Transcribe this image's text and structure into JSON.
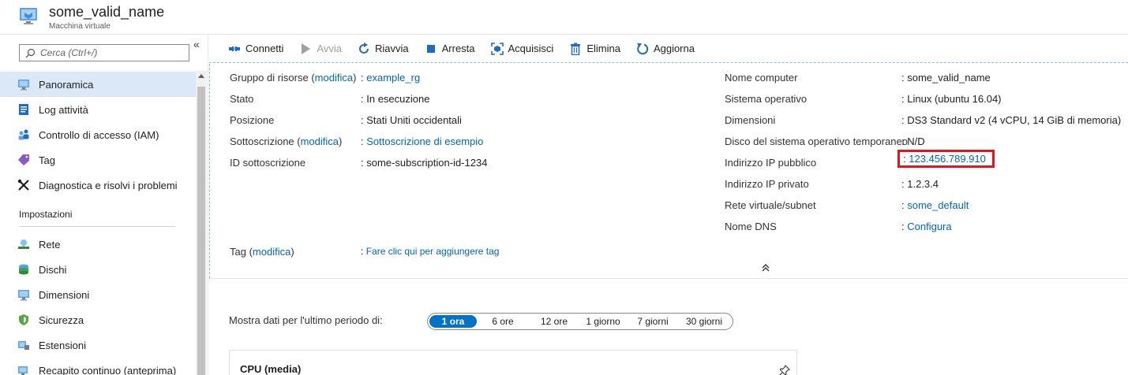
{
  "header": {
    "title": "some_valid_name",
    "subtitle": "Macchina virtuale"
  },
  "sidebar": {
    "collapse_label": "«",
    "search_placeholder": "Cerca (Ctrl+/)",
    "items": [
      {
        "label": "Panoramica",
        "icon": "monitor-icon"
      },
      {
        "label": "Log attività",
        "icon": "log-icon"
      },
      {
        "label": "Controllo di accesso (IAM)",
        "icon": "people-icon"
      },
      {
        "label": "Tag",
        "icon": "tag-icon"
      },
      {
        "label": "Diagnostica e risolvi i problemi",
        "icon": "wrench-icon"
      }
    ],
    "section_title": "Impostazioni",
    "settings_items": [
      {
        "label": "Rete",
        "icon": "network-icon"
      },
      {
        "label": "Dischi",
        "icon": "disks-icon"
      },
      {
        "label": "Dimensioni",
        "icon": "monitor-icon"
      },
      {
        "label": "Sicurezza",
        "icon": "shield-icon"
      },
      {
        "label": "Estensioni",
        "icon": "extensions-icon"
      },
      {
        "label": "Recapito continuo (anteprima)",
        "icon": "rocket-icon"
      }
    ]
  },
  "toolbar": {
    "connect": "Connetti",
    "start": "Avvia",
    "restart": "Riavvia",
    "stop": "Arresta",
    "capture": "Acquisisci",
    "delete": "Elimina",
    "refresh": "Aggiorna"
  },
  "essentials": {
    "left": {
      "resource_group_label": "Gruppo di risorse (",
      "modify": "modifica",
      "close_paren": ")",
      "resource_group_value": "example_rg",
      "status_label": "Stato",
      "status_value": "In esecuzione",
      "location_label": "Posizione",
      "location_value": "Stati Uniti occidentali",
      "subscription_label": "Sottoscrizione (",
      "subscription_value": "Sottoscrizione di esempio",
      "subscription_id_label": "ID sottoscrizione",
      "subscription_id_value": "some-subscription-id-1234",
      "tags_label": "Tag (",
      "tags_value": "Fare clic qui per aggiungere tag"
    },
    "right": {
      "computer_name_label": "Nome computer",
      "computer_name_value": "some_valid_name",
      "os_label": "Sistema operativo",
      "os_value": "Linux (ubuntu 16.04)",
      "size_label": "Dimensioni",
      "size_value": "DS3 Standard v2 (4 vCPU, 14 GiB di memoria)",
      "temp_disk_label": "Disco del sistema operativo temporaneo",
      "temp_disk_value": "N/D",
      "public_ip_label": "Indirizzo IP pubblico",
      "public_ip_value": "123.456.789.910",
      "private_ip_label": "Indirizzo IP privato",
      "private_ip_value": "1.2.3.4",
      "vnet_label": "Rete virtuale/subnet",
      "vnet_value": "some_default",
      "dns_label": "Nome DNS",
      "dns_value": "Configura"
    },
    "colon": ":"
  },
  "metrics": {
    "period_label": "Mostra dati per l'ultimo periodo di:",
    "periods": [
      "1 ora",
      "6 ore",
      "12 ore",
      "1 giorno",
      "7 giorni",
      "30 giorni"
    ],
    "selected_period": "1 ora",
    "cpu_title": "CPU (media)"
  },
  "colors": {
    "accent": "#0072c6",
    "link": "#0066b8",
    "highlight_box": "#e3141c",
    "active_nav": "#dbe8f7"
  }
}
